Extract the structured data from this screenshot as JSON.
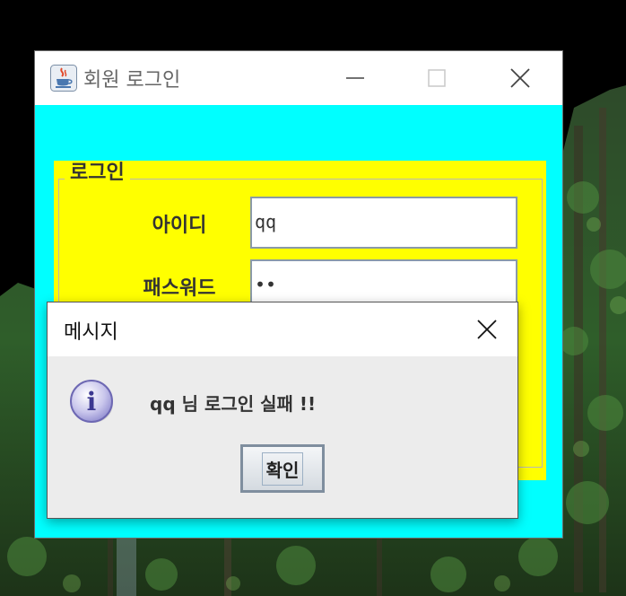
{
  "main_window": {
    "title": "회원 로그인",
    "icon": "java-coffee-cup-icon",
    "background_color": "#00ffff"
  },
  "login_panel": {
    "legend": "로그인",
    "background_color": "#ffff00",
    "id_label": "아이디",
    "id_value": "qq",
    "password_label": "패스워드",
    "password_value": "••"
  },
  "message_dialog": {
    "title": "메시지",
    "icon": "information-icon",
    "message": "qq 님 로그인 실패 !!",
    "ok_label": "확인"
  }
}
